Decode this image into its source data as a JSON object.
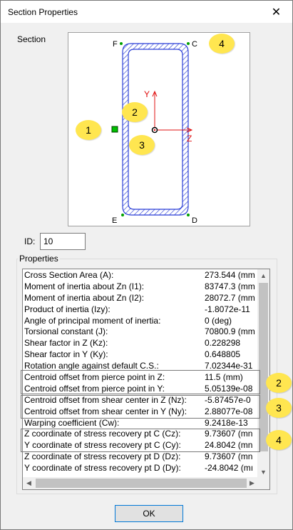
{
  "window": {
    "title": "Section Properties",
    "close_glyph": "✕"
  },
  "section": {
    "label": "Section",
    "point_labels": {
      "F": "F",
      "C": "C",
      "E": "E",
      "D": "D"
    },
    "axes": {
      "y": "Y",
      "z": "Z"
    }
  },
  "callouts": [
    "1",
    "2",
    "3",
    "4",
    "2",
    "3",
    "4"
  ],
  "id_field": {
    "label": "ID:",
    "value": "10"
  },
  "properties": {
    "label": "Properties",
    "rows": [
      {
        "label": "Cross Section Area (A):",
        "value": "273.544 (mm"
      },
      {
        "label": "Moment of inertia about Zn (I1):",
        "value": "83747.3 (mm"
      },
      {
        "label": "Moment of inertia about Zn (I2):",
        "value": "28072.7 (mm"
      },
      {
        "label": "Product of inertia (Izy):",
        "value": "-1.8072e-11"
      },
      {
        "label": "Angle of principal moment of inertia:",
        "value": "0 (deg)"
      },
      {
        "label": "Torsional constant (J):",
        "value": "70800.9 (mm"
      },
      {
        "label": "Shear factor in Z (Kz):",
        "value": "0.228298"
      },
      {
        "label": "Shear factor in Y (Ky):",
        "value": "0.648805"
      },
      {
        "label": "Rotation angle against default C.S.:",
        "value": "7.02344e-31"
      },
      {
        "label": "Centroid offset from pierce point in Z:",
        "value": "11.5 (mm)"
      },
      {
        "label": "Centroid offset from pierce point in Y:",
        "value": "5.05139e-08"
      },
      {
        "label": "Centroid offset from shear center in Z (Nz):",
        "value": "-5.87457e-0"
      },
      {
        "label": "Centroid offset from shear center in Y (Ny):",
        "value": "2.88077e-08"
      },
      {
        "label": "Warping coefficient (Cw):",
        "value": "9.2418e-13"
      },
      {
        "label": "Z coordinate of stress recovery pt C (Cz):",
        "value": "9.73607 (mn"
      },
      {
        "label": "Y coordinate of stress recovery pt C (Cy):",
        "value": "24.8042 (mn"
      },
      {
        "label": "Z coordinate of stress recovery pt D (Dz):",
        "value": "9.73607 (mn"
      },
      {
        "label": "Y coordinate of stress recovery pt D (Dy):",
        "value": "-24.8042 (mı"
      }
    ]
  },
  "ok_label": "OK",
  "colors": {
    "section_outline": "#2b3fd6",
    "axis": "#e01010",
    "point_marker": "#00a000",
    "callout": "#ffe650",
    "ok_border": "#0078d7"
  }
}
